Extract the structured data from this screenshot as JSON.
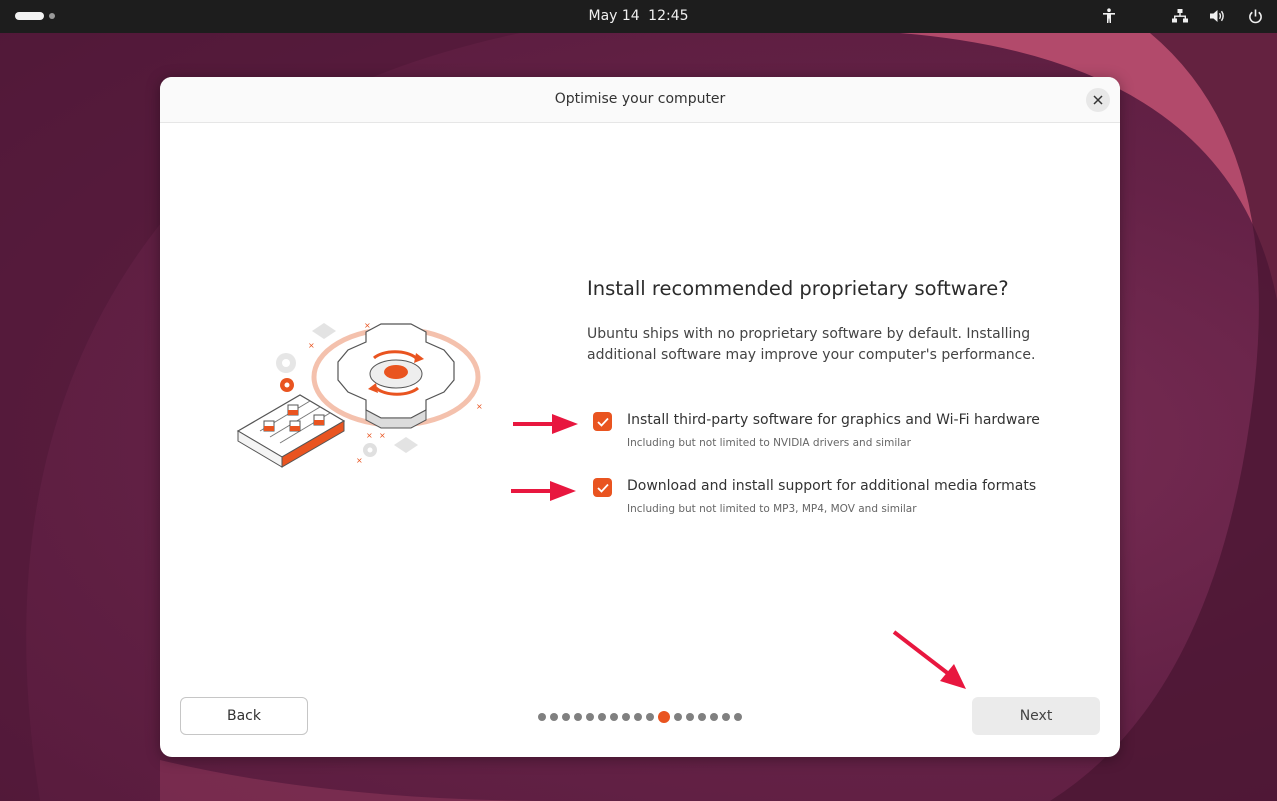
{
  "topbar": {
    "date": "May 14",
    "time": "12:45",
    "icons": [
      "accessibility-icon",
      "network-icon",
      "volume-icon",
      "power-icon"
    ]
  },
  "dialog": {
    "title": "Optimise your computer",
    "heading": "Install recommended proprietary software?",
    "description": "Ubuntu ships with no proprietary software by default. Installing additional software may improve your computer's performance.",
    "options": [
      {
        "label": "Install third-party software for graphics and Wi-Fi hardware",
        "sublabel": "Including but not limited to NVIDIA drivers and similar",
        "checked": true
      },
      {
        "label": "Download and install support for additional media formats",
        "sublabel": "Including but not limited to MP3, MP4, MOV and similar",
        "checked": true
      }
    ],
    "back_label": "Back",
    "next_label": "Next",
    "progress": {
      "total": 17,
      "current": 11
    }
  },
  "colors": {
    "accent": "#e95420",
    "annotation": "#e8173f",
    "topbar": "#1d1d1d",
    "wallpaper": "#652247"
  }
}
